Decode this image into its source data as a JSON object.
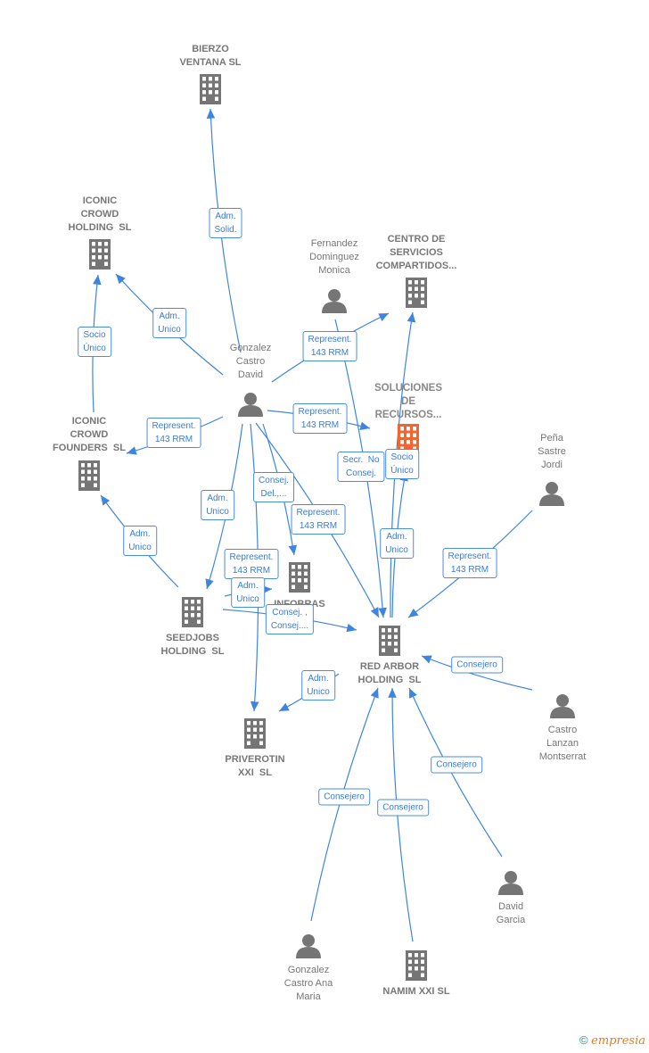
{
  "nodes": [
    {
      "id": "bierzo",
      "type": "company",
      "label": "BIERZO\nVENTANA SL"
    },
    {
      "id": "iconic-holding",
      "type": "company",
      "label": "ICONIC\nCROWD\nHOLDING  SL"
    },
    {
      "id": "fernandez",
      "type": "person",
      "label": "Fernandez\nDominguez\nMonica"
    },
    {
      "id": "centro",
      "type": "company",
      "label": "CENTRO DE\nSERVICIOS\nCOMPARTIDOS..."
    },
    {
      "id": "gonzalez-david",
      "type": "person",
      "label": "Gonzalez\nCastro\nDavid"
    },
    {
      "id": "soluciones",
      "type": "company-highlight",
      "label": "SOLUCIONES\nDE\nRECURSOS..."
    },
    {
      "id": "iconic-founders",
      "type": "company",
      "label": "ICONIC\nCROWD\nFOUNDERS  SL"
    },
    {
      "id": "pena",
      "type": "person",
      "label": "Peña\nSastre\nJordi"
    },
    {
      "id": "infobras",
      "type": "company",
      "label": "INFOBRAS"
    },
    {
      "id": "seedjobs",
      "type": "company",
      "label": "SEEDJOBS\nHOLDING  SL"
    },
    {
      "id": "red-arbor",
      "type": "company",
      "label": "RED ARBOR\nHOLDING  SL"
    },
    {
      "id": "castro-lanzan",
      "type": "person",
      "label": "Castro\nLanzan\nMontserrat"
    },
    {
      "id": "priverotin",
      "type": "company",
      "label": "PRIVEROTIN\nXXI  SL"
    },
    {
      "id": "david-garcia",
      "type": "person",
      "label": "David\nGarcia"
    },
    {
      "id": "gonzalez-ana",
      "type": "person",
      "label": "Gonzalez\nCastro Ana\nMaria"
    },
    {
      "id": "namim",
      "type": "company",
      "label": "NAMIM XXI SL"
    }
  ],
  "edges": [
    {
      "from": "gonzalez-david",
      "to": "bierzo",
      "label": "Adm.\nSolid."
    },
    {
      "from": "gonzalez-david",
      "to": "iconic-holding",
      "label": "Adm.\nUnico"
    },
    {
      "from": "iconic-founders",
      "to": "iconic-holding",
      "label": "Socio\nÚnico"
    },
    {
      "from": "gonzalez-david",
      "to": "iconic-founders",
      "label": "Represent.\n143 RRM"
    },
    {
      "from": "gonzalez-david",
      "to": "centro",
      "label": "Represent.\n143 RRM"
    },
    {
      "from": "gonzalez-david",
      "to": "soluciones",
      "label": "Represent.\n143 RRM"
    },
    {
      "from": "fernandez",
      "to": "red-arbor",
      "label": "Secr.  No\nConsej."
    },
    {
      "from": "red-arbor",
      "to": "soluciones",
      "label": "Socio\nÚnico"
    },
    {
      "from": "red-arbor",
      "to": "centro",
      "label": "Adm.\nUnico"
    },
    {
      "from": "pena",
      "to": "red-arbor",
      "label": "Represent.\n143 RRM"
    },
    {
      "from": "castro-lanzan",
      "to": "red-arbor",
      "label": "Consejero"
    },
    {
      "from": "david-garcia",
      "to": "red-arbor",
      "label": "Consejero"
    },
    {
      "from": "gonzalez-ana",
      "to": "red-arbor",
      "label": "Consejero"
    },
    {
      "from": "namim",
      "to": "red-arbor",
      "label": "Consejero"
    },
    {
      "from": "gonzalez-david",
      "to": "seedjobs",
      "label": "Adm.\nUnico"
    },
    {
      "from": "seedjobs",
      "to": "iconic-founders",
      "label": "Adm.\nUnico"
    },
    {
      "from": "gonzalez-david",
      "to": "infobras",
      "label": "Consej.\nDel.,..."
    },
    {
      "from": "gonzalez-david",
      "to": "red-arbor",
      "label": "Represent.\n143 RRM"
    },
    {
      "from": "gonzalez-david",
      "to": "priverotin",
      "label": "Represent.\n143 RRM"
    },
    {
      "from": "seedjobs",
      "to": "infobras",
      "label": "Adm.\nUnico"
    },
    {
      "from": "seedjobs",
      "to": "red-arbor",
      "label": "Consej. ,\nConsej...."
    },
    {
      "from": "red-arbor",
      "to": "priverotin",
      "label": "Adm.\nUnico"
    }
  ],
  "colors": {
    "edge": "#3d85e0",
    "company": "#757575",
    "highlight": "#f26531",
    "person": "#757575"
  },
  "credit": {
    "symbol": "©",
    "brand": "empresia"
  }
}
